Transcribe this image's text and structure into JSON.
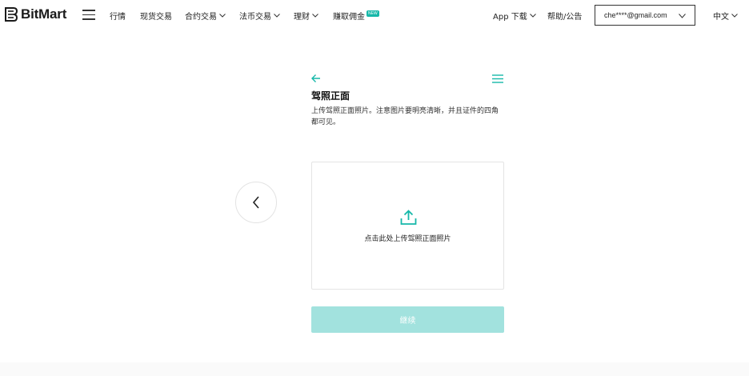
{
  "header": {
    "brand": "BitMart",
    "nav": [
      {
        "label": "行情"
      },
      {
        "label": "现货交易"
      },
      {
        "label": "合约交易"
      },
      {
        "label": "法币交易"
      },
      {
        "label": "理财"
      },
      {
        "label": "赚取佣金",
        "badge": "NEW"
      }
    ],
    "app_download": "App 下载",
    "help": "帮助/公告",
    "account_email": "che****@gmail.com",
    "language": "中文"
  },
  "main": {
    "title": "驾照正面",
    "description": "上传驾照正面照片。注意图片要明亮清晰，并且证件的四角都可见。",
    "upload_label": "点击此处上传驾照正面照片",
    "continue_label": "继续"
  },
  "colors": {
    "accent": "#16b8a9",
    "button_disabled": "#a2e2de"
  },
  "icons": [
    "bitmart-logo",
    "hamburger-menu-icon",
    "chevron-down-icon",
    "arrow-left-icon",
    "menu-icon",
    "chevron-left-icon",
    "upload-icon"
  ]
}
